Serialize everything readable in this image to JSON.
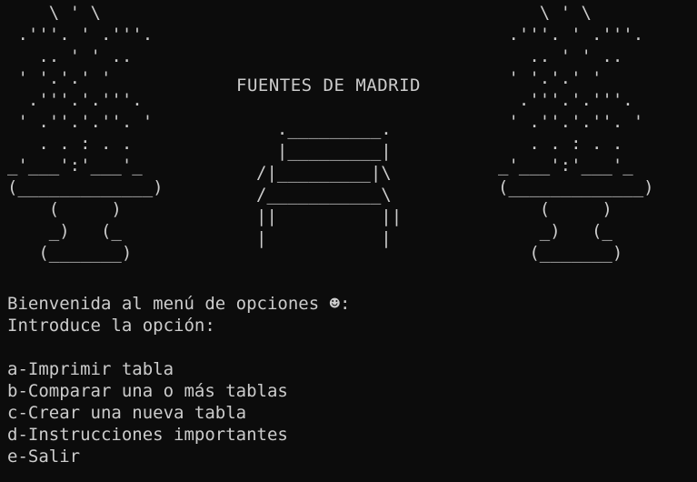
{
  "window": {
    "background": "#0c0c0c",
    "foreground": "#cccccc"
  },
  "art": {
    "fountain_left": " \\ ' \\\n .'''. ' .'''.\n .. ' ' ..\n ' '.'.' '\n .'''.'.'''.\n ' .''.'.''. '\n . . : . .\n_'___':'___'_\n(_____________)\n (     )\n _)   (_\n (_______)",
    "fountain_right": " \\ ' \\\n .'''. ' .'''.\n .. ' ' ..\n ' '.'.' '\n .'''.'.'''.\n ' .''.'.''. '\n . . : . .\n_'___':'___'_\n(_____________)\n (     )\n _)   (_\n (_______)",
    "bench": "  ._________.\n  |_________|\n/|_________|\\\n/___________\\\n||          ||\n|           |"
  },
  "title": "FUENTES DE MADRID",
  "menu": {
    "welcome": "Bienvenida al menú de opciones ☻:",
    "prompt": "Introduce la opción:",
    "options": [
      "a-Imprimir tabla",
      "b-Comparar una o más tablas",
      "c-Crear una nueva tabla",
      "d-Instrucciones importantes",
      "e-Salir"
    ]
  }
}
